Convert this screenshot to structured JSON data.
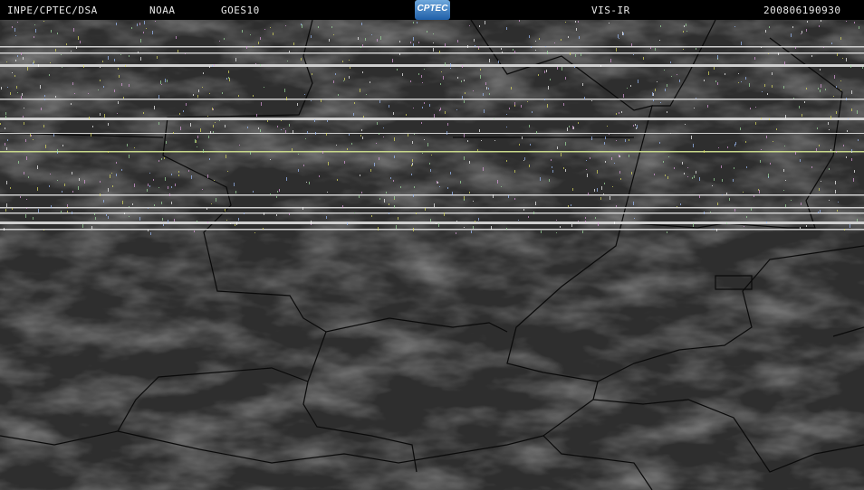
{
  "header": {
    "agency": "INPE/CPTEC/DSA",
    "operator": "NOAA",
    "satellite": "GOES10",
    "channel": "VIS-IR",
    "timestamp": "200806190930",
    "logo_text": "CPTEC"
  },
  "colors": {
    "background": "#2c2c2c",
    "border": "#000000",
    "scanline": "#cfcfcf"
  }
}
